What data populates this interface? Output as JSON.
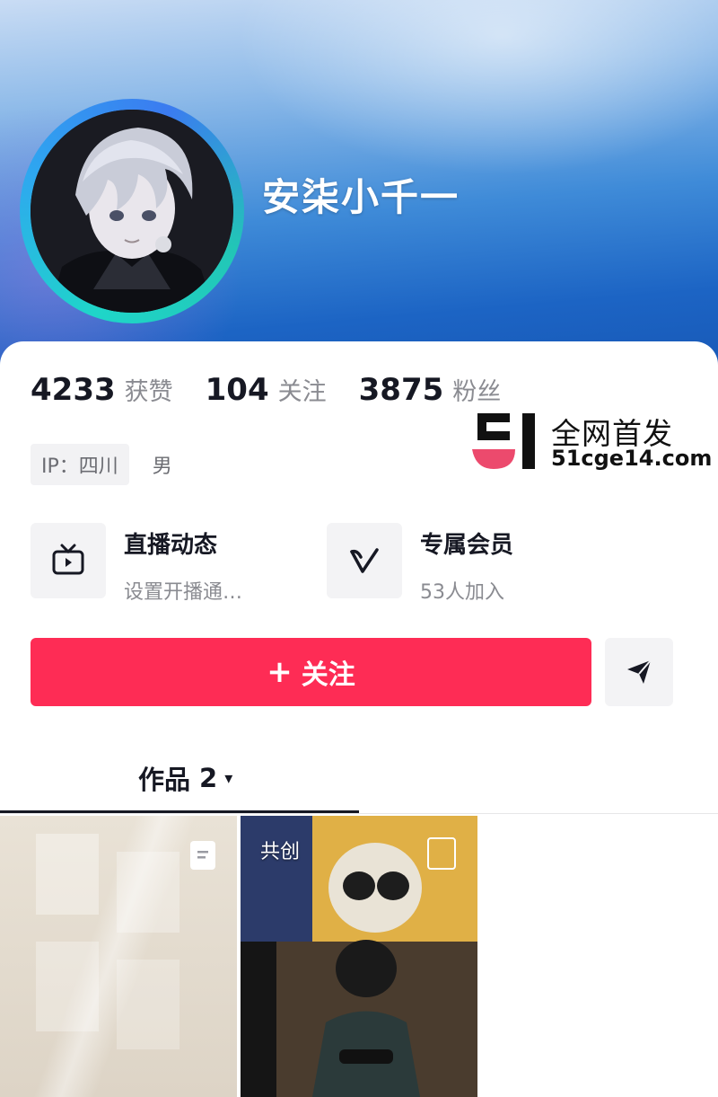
{
  "profile": {
    "nickname": "安柒小千一",
    "stats": [
      {
        "value": "4233",
        "label": "获赞"
      },
      {
        "value": "104",
        "label": "关注"
      },
      {
        "value": "3875",
        "label": "粉丝"
      }
    ],
    "ip_tag": "IP：四川",
    "gender": "男"
  },
  "watermark": {
    "title": "全网首发",
    "url": "51cge14.com"
  },
  "services": [
    {
      "icon": "tv-icon",
      "title": "直播动态",
      "subtitle": "设置开播通…"
    },
    {
      "icon": "v-icon",
      "title": "专属会员",
      "subtitle": "53人加入"
    }
  ],
  "actions": {
    "follow_plus": "+",
    "follow_label": "关注",
    "message_icon": "send-icon"
  },
  "tabs": {
    "works_label": "作品",
    "works_count": "2",
    "caret": "▾"
  },
  "grid": {
    "item2_badge": "共创"
  },
  "colors": {
    "accent": "#fe2c55",
    "header_blue": "#1c64c4"
  }
}
